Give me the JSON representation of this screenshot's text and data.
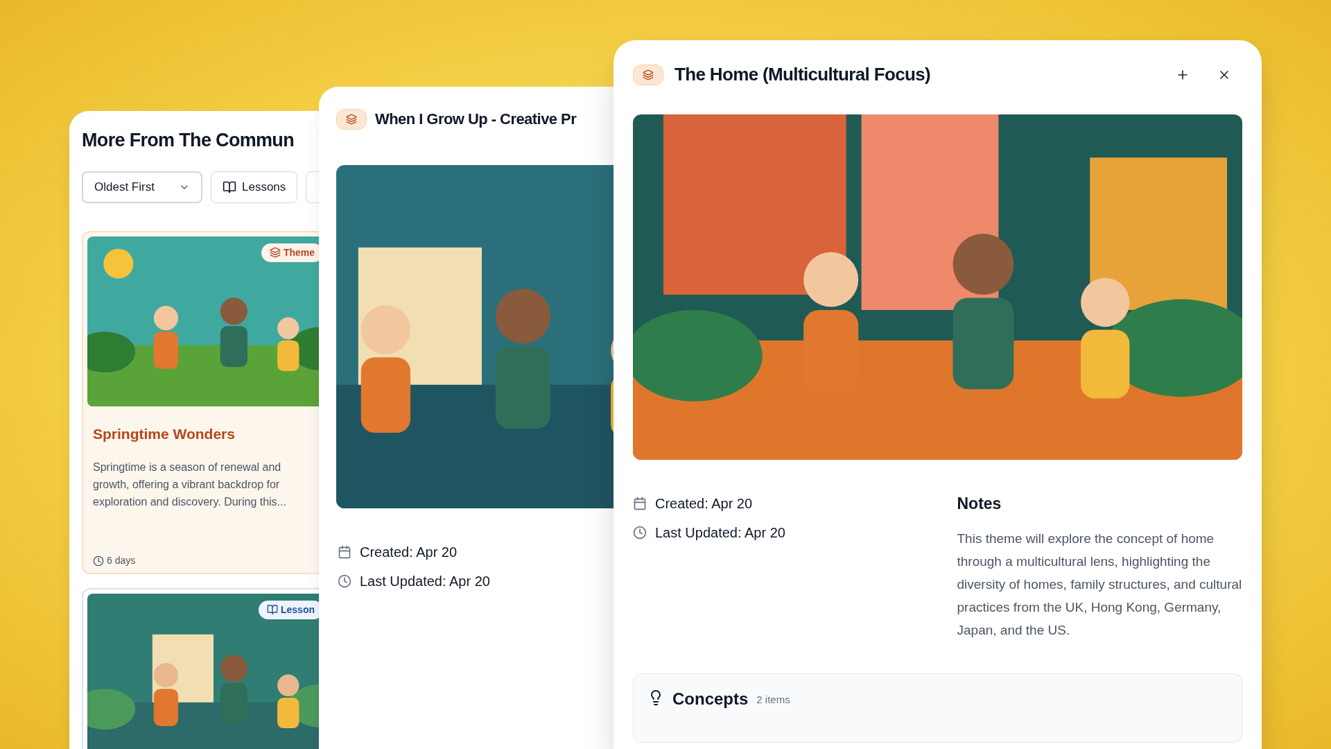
{
  "community_panel": {
    "title": "More From The Commun",
    "sort_dropdown": {
      "value": "Oldest First"
    },
    "filter_buttons": [
      {
        "label": "Lessons"
      }
    ],
    "cards": [
      {
        "badge": {
          "kind": "theme",
          "label": "Theme"
        },
        "title": "Springtime Wonders",
        "description": "Springtime is a season of renewal and growth, offering a vibrant backdrop for exploration and discovery. During this...",
        "duration": "6 days"
      },
      {
        "badge": {
          "kind": "lesson",
          "label": "Lesson"
        }
      }
    ]
  },
  "middle_panel": {
    "title": "When I Grow Up - Creative Pr",
    "created": {
      "label": "Created:",
      "value": "Apr 20"
    },
    "updated": {
      "label": "Last Updated:",
      "value": "Apr 20"
    }
  },
  "detail_panel": {
    "title": "The Home (Multicultural Focus)",
    "created": {
      "label": "Created:",
      "value": "Apr 20"
    },
    "updated": {
      "label": "Last Updated:",
      "value": "Apr 20"
    },
    "notes": {
      "title": "Notes",
      "text": "This theme will explore the concept of home through a multicultural lens, highlighting the diversity of homes, family structures, and cultural practices from the UK, Hong Kong, Germany, Japan, and the US."
    },
    "concepts": {
      "title": "Concepts",
      "count": "2 items"
    }
  }
}
